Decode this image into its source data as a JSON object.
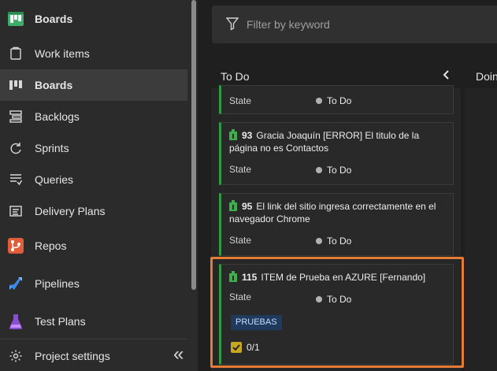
{
  "sidebar": {
    "section_title": "Boards",
    "items": [
      {
        "label": "Work items",
        "icon": "work-items-icon"
      },
      {
        "label": "Boards",
        "icon": "boards-icon",
        "selected": true
      },
      {
        "label": "Backlogs",
        "icon": "backlogs-icon"
      },
      {
        "label": "Sprints",
        "icon": "sprints-icon"
      },
      {
        "label": "Queries",
        "icon": "queries-icon"
      },
      {
        "label": "Delivery Plans",
        "icon": "delivery-plans-icon"
      },
      {
        "label": "Repos",
        "icon": "repos-icon"
      },
      {
        "label": "Pipelines",
        "icon": "pipelines-icon"
      },
      {
        "label": "Test Plans",
        "icon": "test-plans-icon"
      }
    ],
    "settings_label": "Project settings",
    "collapse_glyph": "«"
  },
  "filter": {
    "placeholder": "Filter by keyword"
  },
  "columns": {
    "todo": "To Do",
    "doing": "Doing"
  },
  "cards": [
    {
      "field": "State",
      "state": "To Do"
    },
    {
      "id": "93",
      "title": "Gracia Joaquín [ERROR] El titulo de la página no es Contactos",
      "field": "State",
      "state": "To Do"
    },
    {
      "id": "95",
      "title": "El link del sitio ingresa correctamente en el navegador Chrome",
      "field": "State",
      "state": "To Do"
    },
    {
      "id": "115",
      "title": "ITEM de Prueba en AZURE [Fernando]",
      "field": "State",
      "state": "To Do",
      "tag": "PRUEBAS",
      "checklist": "0/1"
    }
  ],
  "colors": {
    "accent_green": "#339947",
    "highlight_orange": "#e57c35",
    "checklist_yellow": "#c7a722"
  }
}
